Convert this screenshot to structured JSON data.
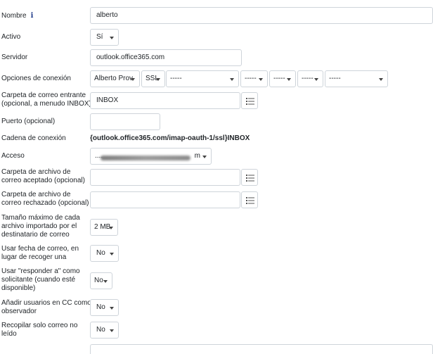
{
  "form": {
    "nombre": {
      "label": "Nombre",
      "value": "alberto"
    },
    "activo": {
      "label": "Activo",
      "value": "Sí"
    },
    "servidor": {
      "label": "Servidor",
      "value": "outlook.office365.com"
    },
    "opciones": {
      "label": "Opciones de conexión",
      "selects": [
        "Alberto Prov",
        "SSL",
        "-----",
        "-----",
        "-----",
        "-----",
        "-----"
      ]
    },
    "carpeta_entrante": {
      "label_line1": "Carpeta de correo entrante",
      "label_line2": "(opcional, a menudo INBOX)",
      "value": "INBOX"
    },
    "puerto": {
      "label": "Puerto (opcional)",
      "value": ""
    },
    "cadena": {
      "label": "Cadena de conexión",
      "value": "{outlook.office365.com/imap-oauth-1/ssl}INBOX"
    },
    "acceso": {
      "label": "Acceso",
      "prefix": "....",
      "suffix": "m"
    },
    "archivo_aceptado": {
      "label_line1": "Carpeta de archivo de",
      "label_line2": "correo aceptado (opcional)",
      "value": ""
    },
    "archivo_rechazado": {
      "label_line1": "Carpeta de archivo de",
      "label_line2": "correo rechazado (opcional)",
      "value": ""
    },
    "tamano": {
      "label_line1": "Tamaño máximo de cada",
      "label_line2": "archivo importado por el",
      "label_line3": "destinatario de correo",
      "value": "2 MB"
    },
    "usar_fecha": {
      "label_line1": "Usar fecha de correo, en",
      "label_line2": "lugar de recoger una",
      "value": "No"
    },
    "responder": {
      "label_line1": "Usar \"responder a\" como",
      "label_line2": "solicitante (cuando esté",
      "label_line3": "disponible)",
      "value": "No"
    },
    "anadir_cc": {
      "label_line1": "Añadir usuarios en CC como",
      "label_line2": "observador",
      "value": "No"
    },
    "recopilar": {
      "label_line1": "Recopilar solo correo no",
      "label_line2": "leído",
      "value": "No"
    }
  }
}
